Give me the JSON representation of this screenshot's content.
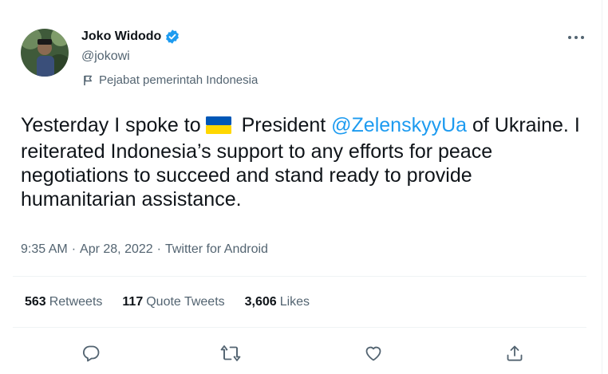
{
  "author": {
    "name": "Joko Widodo",
    "handle": "@jokowi",
    "label": "Pejabat pemerintah Indonesia",
    "verified": true
  },
  "tweet": {
    "text_before": "Yesterday I spoke to",
    "flag": "Ukraine flag",
    "text_middle": "President",
    "mention": "@ZelenskyyUa",
    "text_after": "of Ukraine. I reiterated Indonesia’s support to any efforts for peace negotiations to succeed and stand ready to provide humanitarian assistance."
  },
  "meta": {
    "time": "9:35 AM",
    "separator": "·",
    "date": "Apr 28, 2022",
    "source": "Twitter for Android"
  },
  "stats": {
    "retweets_count": "563",
    "retweets_label": "Retweets",
    "quotes_count": "117",
    "quotes_label": "Quote Tweets",
    "likes_count": "3,606",
    "likes_label": "Likes"
  },
  "icons": {
    "reply": "reply-icon",
    "retweet": "retweet-icon",
    "like": "like-icon",
    "share": "share-icon",
    "more": "more-icon",
    "verified": "verified-badge-icon",
    "label_flag": "flag-icon"
  },
  "colors": {
    "accent": "#1d9bf0",
    "text": "#0f1419",
    "secondary": "#536471",
    "ukraine_blue": "#0057b7",
    "ukraine_yellow": "#ffd700"
  }
}
